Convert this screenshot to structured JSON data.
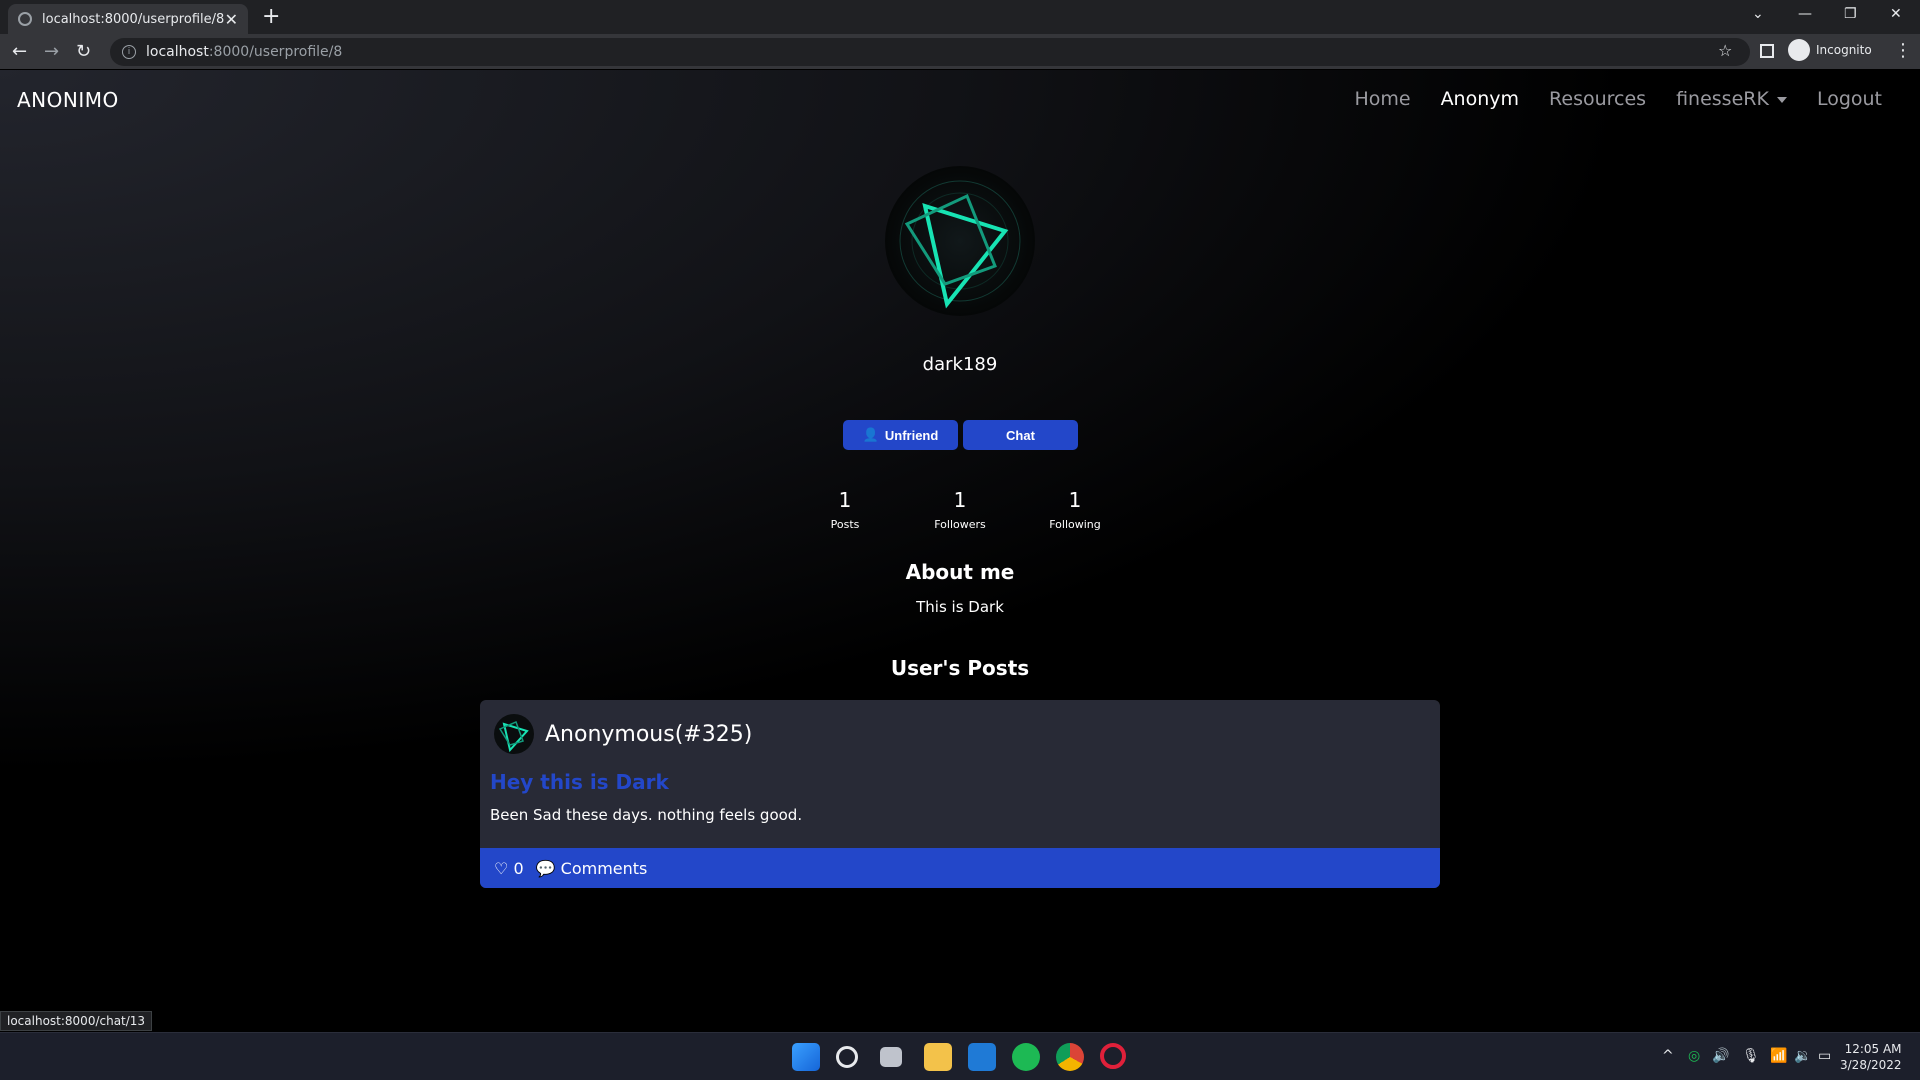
{
  "browser": {
    "tab_title": "localhost:8000/userprofile/8",
    "tab_close": "✕",
    "new_tab": "+",
    "url_host": "localhost",
    "url_path": ":8000/userprofile/8",
    "incognito_label": "Incognito",
    "status_url": "localhost:8000/chat/13"
  },
  "nav": {
    "brand": "ANONIMO",
    "links": [
      "Home",
      "Anonym",
      "Resources",
      "finesseRK",
      "Logout"
    ]
  },
  "profile": {
    "username": "dark189",
    "unfriend_label": "Unfriend",
    "chat_label": "Chat",
    "stats": [
      {
        "value": "1",
        "label": "Posts"
      },
      {
        "value": "1",
        "label": "Followers"
      },
      {
        "value": "1",
        "label": "Following"
      }
    ],
    "about_heading": "About me",
    "about_text": "This is Dark",
    "posts_heading": "User's Posts"
  },
  "post": {
    "author": "Anonymous(#325)",
    "title": "Hey this is Dark",
    "body": "Been Sad these days. nothing feels good.",
    "likes": "0",
    "comments_label": "Comments"
  },
  "taskbar": {
    "time": "12:05 AM",
    "date": "3/28/2022"
  },
  "colors": {
    "accent": "#2347c9",
    "card": "#282a36",
    "avatar_line": "#17e3b3"
  }
}
